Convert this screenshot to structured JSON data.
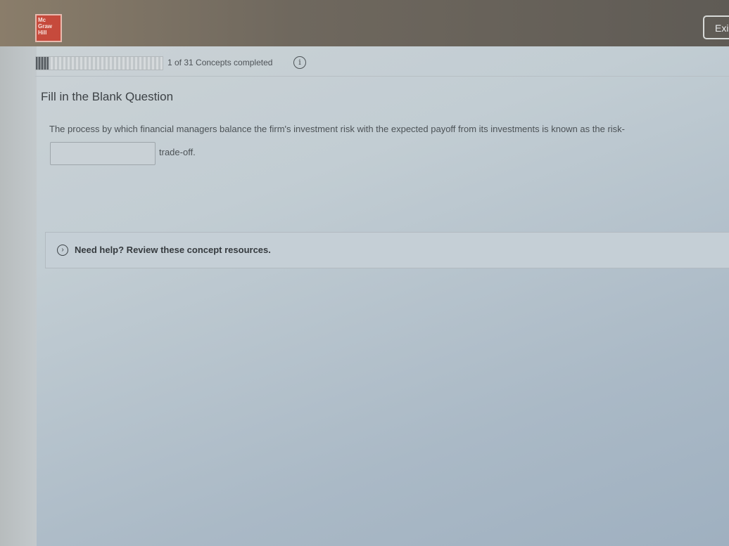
{
  "header": {
    "logo_lines": [
      "Mc",
      "Graw",
      "Hill"
    ],
    "exit_label": "Exi"
  },
  "progress": {
    "completed": 1,
    "total": 31,
    "text": "1 of 31 Concepts completed",
    "info_icon": "info-icon"
  },
  "question": {
    "title": "Fill in the Blank Question",
    "text": "The process by which financial managers balance the firm's investment risk with the expected payoff from its investments is known as the risk-",
    "answer_value": "",
    "trailing_text": "trade-off."
  },
  "help": {
    "icon": "chevron-right-circle-icon",
    "label": "Need help? Review these concept resources."
  }
}
